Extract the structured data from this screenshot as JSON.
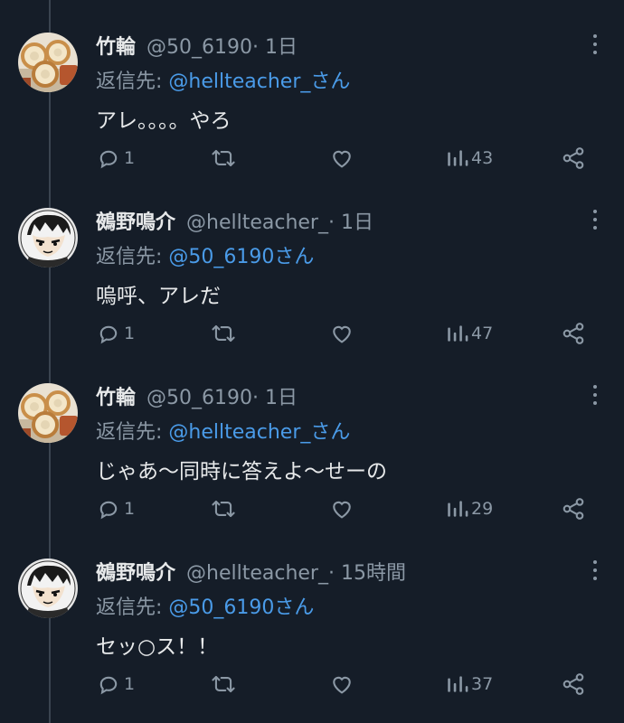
{
  "thread": {
    "tweets": [
      {
        "name": "竹輪",
        "handle": "@50_6190",
        "time": " · 1日",
        "reply_prefix": "返信先: ",
        "reply_mention": "@hellteacher_さん",
        "text": "アレ。。。。やろ",
        "replies": "1",
        "views": "43",
        "avatar": "chikuwa"
      },
      {
        "name": "鵺野鳴介",
        "handle": "@hellteacher_",
        "time": " · 1日",
        "reply_prefix": "返信先: ",
        "reply_mention": "@50_6190さん",
        "text": "嗚呼、アレだ",
        "replies": "1",
        "views": "47",
        "avatar": "anime"
      },
      {
        "name": "竹輪",
        "handle": "@50_6190",
        "time": " · 1日",
        "reply_prefix": "返信先: ",
        "reply_mention": "@hellteacher_さん",
        "text": "じゃあ〜同時に答えよ〜せーの",
        "replies": "1",
        "views": "29",
        "avatar": "chikuwa"
      },
      {
        "name": "鵺野鳴介",
        "handle": "@hellteacher_",
        "time": " · 15時間",
        "reply_prefix": "返信先: ",
        "reply_mention": "@50_6190さん",
        "text": "セッ○ス！！",
        "replies": "1",
        "views": "37",
        "avatar": "anime"
      }
    ]
  },
  "icons": {
    "more": "more-dots-icon",
    "reply": "reply-icon",
    "retweet": "retweet-icon",
    "like": "heart-icon",
    "views": "views-icon",
    "share": "share-icon"
  },
  "colors": {
    "background": "#151d28",
    "text": "#e7e9ea",
    "muted": "#8b98a5",
    "mention": "#4a9be8"
  }
}
